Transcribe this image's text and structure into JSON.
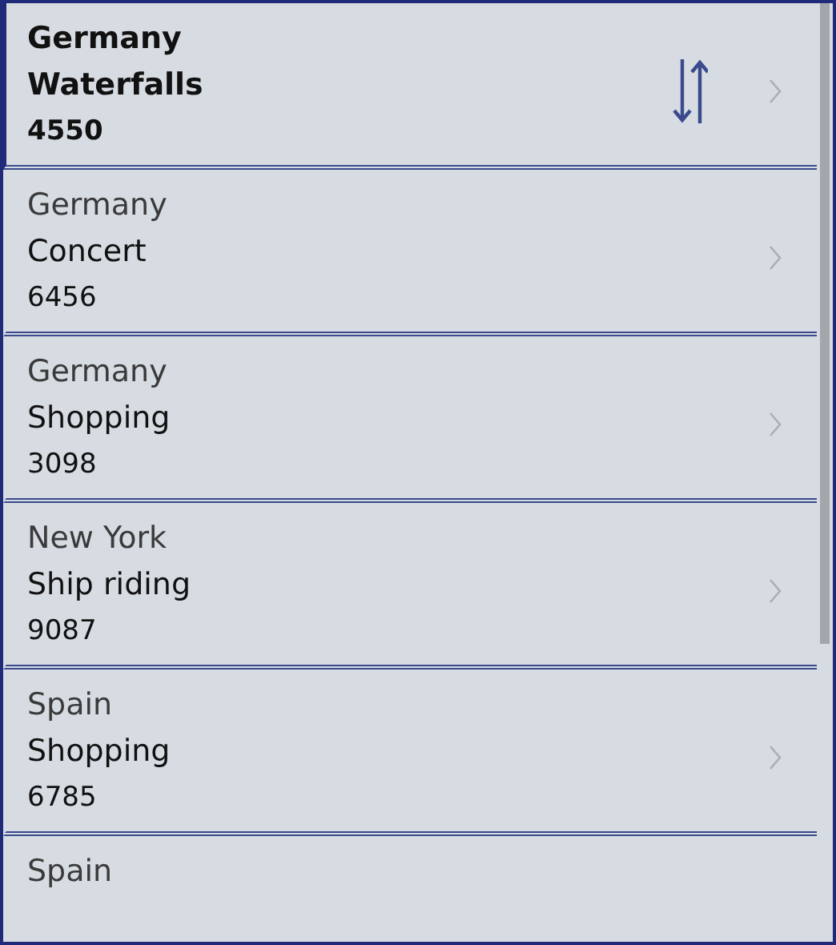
{
  "gallery": {
    "items": [
      {
        "title": "Germany",
        "subtitle": "Waterfalls",
        "value": "4550",
        "selected": true
      },
      {
        "title": "Germany",
        "subtitle": "Concert",
        "value": "6456",
        "selected": false
      },
      {
        "title": "Germany",
        "subtitle": "Shopping",
        "value": "3098",
        "selected": false
      },
      {
        "title": "New York",
        "subtitle": "Ship riding",
        "value": "9087",
        "selected": false
      },
      {
        "title": "Spain",
        "subtitle": "Shopping",
        "value": "6785",
        "selected": false
      },
      {
        "title": "Spain",
        "selected": false
      }
    ]
  }
}
